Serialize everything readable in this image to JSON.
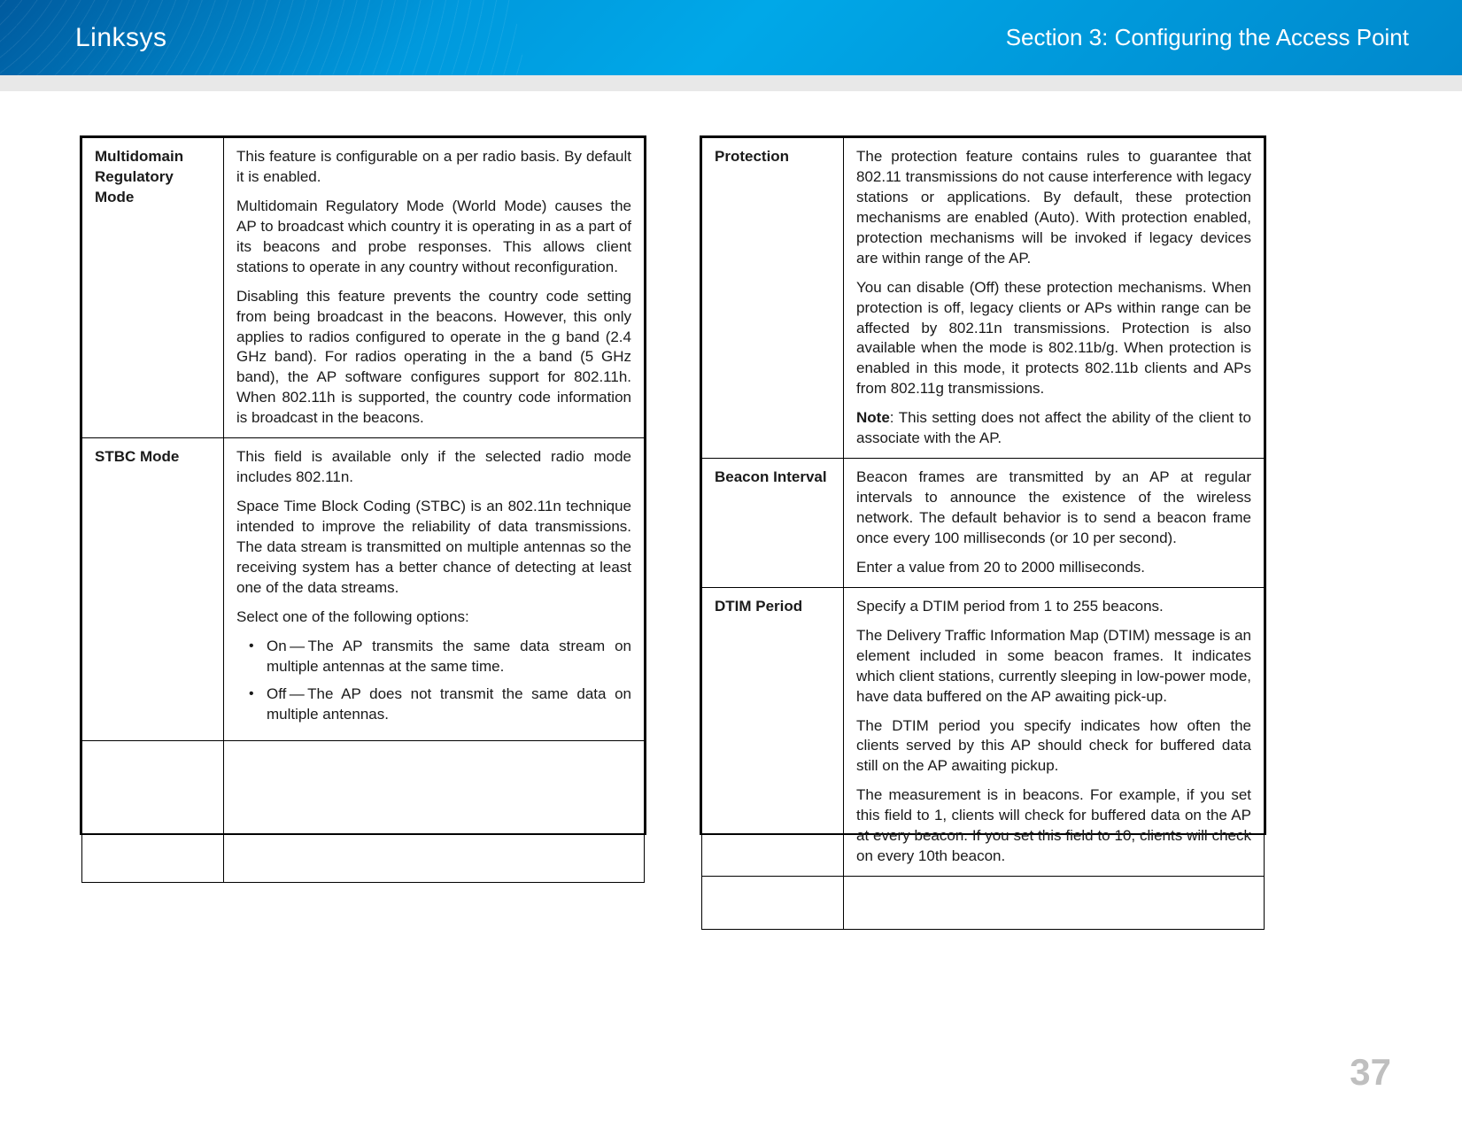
{
  "header": {
    "brand": "Linksys",
    "section": "Section 3:  Configuring the Access Point"
  },
  "page_number": "37",
  "left_table": {
    "row1": {
      "label": "Multidomain Regulatory Mode",
      "p1": "This feature is configurable on a per radio basis. By default it is enabled.",
      "p2": "Multidomain Regulatory Mode (World Mode) causes the AP to broadcast which country it is operating in as a part of its beacons and probe responses. This allows client stations to operate in any country without reconfiguration.",
      "p3": "Disabling this feature prevents the country code setting from being broadcast in the beacons. However, this only applies to radios configured to operate in the g band (2.4 GHz band). For radios operating in the a band (5 GHz band), the AP software configures support for 802.11h. When 802.11h is supported, the country code information is broadcast in the beacons."
    },
    "row2": {
      "label": "STBC Mode",
      "p1": "This field is available only if the selected radio mode includes 802.11n.",
      "p2": "Space Time Block Coding (STBC) is an 802.11n technique intended to improve the reliability of data transmissions. The data stream is transmitted on multiple antennas so the receiving system has a better chance of detecting at least one of the data streams.",
      "p3": "Select one of the following options:",
      "opt1": "On — The AP transmits the same data stream on multiple antennas at the same time.",
      "opt2": "Off — The AP does not transmit the same data on multiple antennas."
    }
  },
  "right_table": {
    "row1": {
      "label": "Protection",
      "p1": "The protection feature contains rules to guarantee that 802.11 transmissions do not cause interference with legacy stations or applications. By default, these protection mechanisms are enabled (Auto). With protection enabled, protection mechanisms will be invoked if legacy devices are within range of the AP.",
      "p2": "You can disable (Off) these protection mechanisms. When protection is off, legacy clients or APs within range can be affected by 802.11n transmissions. Protection is also available when the mode is 802.11b/g. When protection is enabled in this mode, it protects 802.11b clients and APs from 802.11g transmissions.",
      "note_label": "Note",
      "note_text": ":    This setting does not affect the ability of the client to associate with the AP."
    },
    "row2": {
      "label": "Beacon Interval",
      "p1": "Beacon frames are transmitted by an AP at regular intervals to announce the existence of the wireless network. The default behavior is to send a beacon frame once every 100 milliseconds (or 10 per second).",
      "p2": "Enter a value from 20 to 2000 milliseconds."
    },
    "row3": {
      "label": "DTIM Period",
      "p1": "Specify a DTIM period from 1 to 255 beacons.",
      "p2": "The Delivery Traffic Information Map (DTIM) message is an element included in some beacon frames. It indicates which client stations, currently sleeping in low-power mode, have data buffered on the AP awaiting pick-up.",
      "p3": "The DTIM period you specify indicates how often the clients served by this AP should check for buffered data still on the AP awaiting pickup.",
      "p4": "The measurement is in beacons. For example, if you set this field to 1, clients will check for buffered data on the AP at every beacon. If you set this field to 10, clients will check on every 10th beacon."
    }
  }
}
